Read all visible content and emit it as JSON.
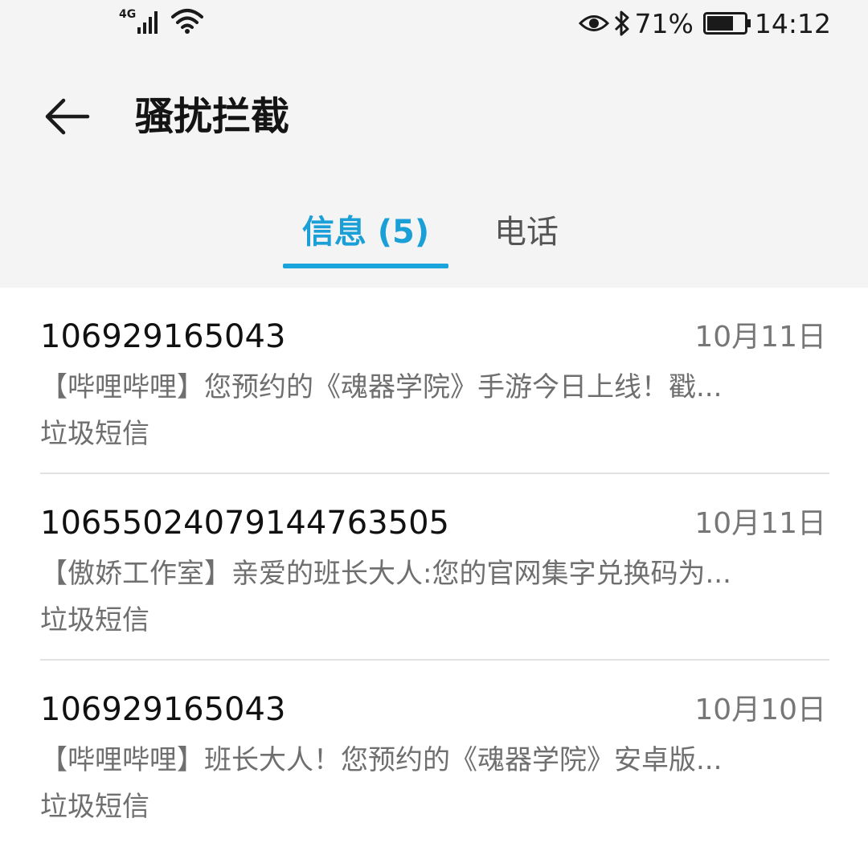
{
  "status_bar": {
    "network_type": "4G",
    "battery_percent": "71%",
    "battery_level": 0.71,
    "time": "14:12",
    "icons": [
      "signal-icon",
      "wifi-icon",
      "eye-icon",
      "bluetooth-icon",
      "battery-icon"
    ]
  },
  "header": {
    "title": "骚扰拦截"
  },
  "tabs": [
    {
      "label": "信息 (5)",
      "active": true
    },
    {
      "label": "电话",
      "active": false
    }
  ],
  "colors": {
    "accent": "#1a9fd6",
    "header_bg": "#f4f4f4",
    "text_primary": "#111111",
    "text_secondary": "#6f6f6f"
  },
  "messages": [
    {
      "sender": "106929165043",
      "date": "10月11日",
      "preview": "【哔哩哔哩】您预约的《魂器学院》手游今日上线！戳...",
      "tag": "垃圾短信"
    },
    {
      "sender": "10655024079144763505",
      "date": "10月11日",
      "preview": "【傲娇工作室】亲爱的班长大人:您的官网集字兑换码为...",
      "tag": "垃圾短信"
    },
    {
      "sender": "106929165043",
      "date": "10月10日",
      "preview": "【哔哩哔哩】班长大人！您预约的《魂器学院》安卓版...",
      "tag": "垃圾短信"
    }
  ]
}
